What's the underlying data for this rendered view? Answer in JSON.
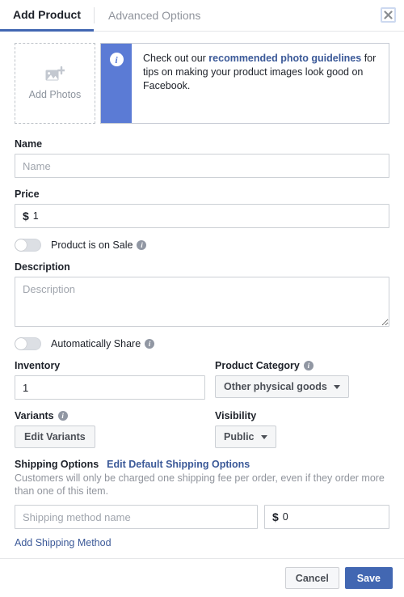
{
  "tabs": [
    {
      "label": "Add Product",
      "active": true
    },
    {
      "label": "Advanced Options",
      "active": false
    }
  ],
  "close_icon": "close-icon",
  "photos": {
    "icon": "add-photo-icon",
    "label": "Add Photos"
  },
  "guidelines": {
    "icon": "info-icon",
    "text_before": "Check out our ",
    "link": "recommended photo guidelines",
    "text_after": " for tips on making your product images look good on Facebook."
  },
  "name_field": {
    "label": "Name",
    "placeholder": "Name",
    "value": ""
  },
  "price_field": {
    "label": "Price",
    "currency": "$",
    "value": "1"
  },
  "sale_toggle": {
    "label": "Product is on Sale",
    "state": "off",
    "info_icon": "info-icon"
  },
  "description_field": {
    "label": "Description",
    "placeholder": "Description",
    "value": ""
  },
  "auto_share_toggle": {
    "label": "Automatically Share",
    "state": "off",
    "info_icon": "info-icon"
  },
  "inventory_field": {
    "label": "Inventory",
    "value": "1"
  },
  "product_category": {
    "label": "Product Category",
    "selected": "Other physical goods",
    "info_icon": "info-icon",
    "caret_icon": "chevron-down-icon"
  },
  "variants": {
    "label": "Variants",
    "button_label": "Edit Variants",
    "info_icon": "info-icon"
  },
  "visibility": {
    "label": "Visibility",
    "selected": "Public",
    "caret_icon": "chevron-down-icon"
  },
  "shipping": {
    "title": "Shipping Options",
    "edit_link": "Edit Default Shipping Options",
    "note": "Customers will only be charged one shipping fee per order, even if they order more than one of this item.",
    "method_placeholder": "Shipping method name",
    "method_value": "",
    "price_currency": "$",
    "price_value": "0",
    "add_link": "Add Shipping Method"
  },
  "footer": {
    "cancel_label": "Cancel",
    "save_label": "Save"
  },
  "colors": {
    "brand_blue": "#4267b2",
    "link_blue": "#3b5998",
    "info_panel_blue": "#5b7bd5",
    "text_dark": "#1d2129",
    "text_muted": "#90949c",
    "border": "#ccd0d5"
  }
}
